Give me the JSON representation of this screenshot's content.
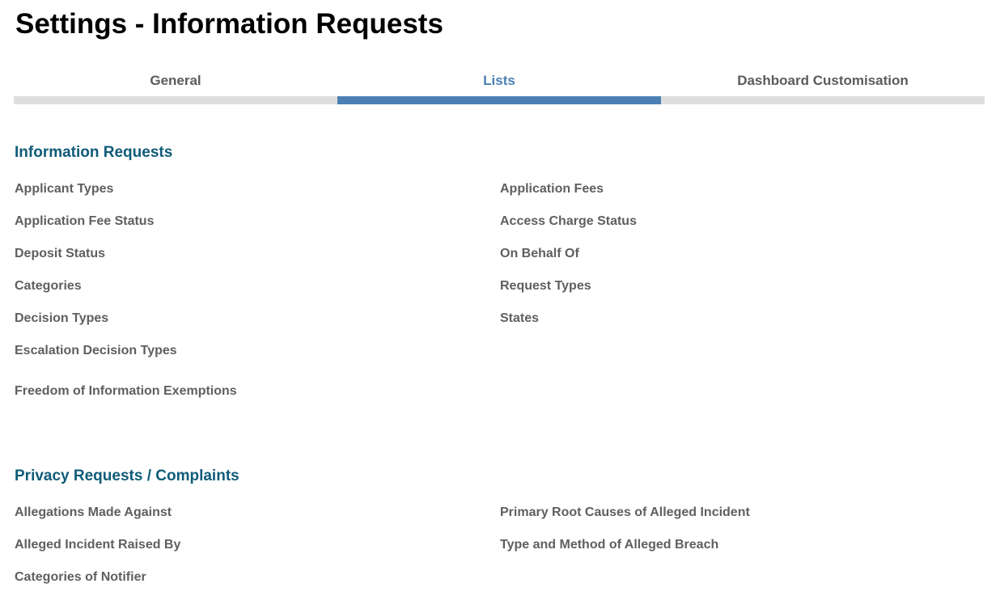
{
  "page": {
    "title": "Settings - Information Requests"
  },
  "tabs": [
    {
      "label": "General",
      "active": false
    },
    {
      "label": "Lists",
      "active": true
    },
    {
      "label": "Dashboard Customisation",
      "active": false
    }
  ],
  "colors": {
    "accent": "#4a7fb3",
    "section_heading": "#0f5b78",
    "inactive_tab_bar": "#dedede",
    "link_text": "#5f5f5f"
  },
  "information_requests": {
    "heading": "Information Requests",
    "left_items": [
      "Applicant Types",
      "Application Fee Status",
      "Deposit Status",
      "Categories",
      "Decision Types",
      "Escalation Decision Types",
      "Freedom of Information Exemptions"
    ],
    "right_items": [
      "Application Fees",
      "Access Charge Status",
      "On Behalf Of",
      "Request Types",
      "States"
    ]
  },
  "privacy_requests": {
    "heading": "Privacy Requests / Complaints",
    "left_items": [
      "Allegations Made Against",
      "Alleged Incident Raised By",
      "Categories of Notifier"
    ],
    "right_items": [
      "Primary Root Causes of Alleged Incident",
      "Type and Method of Alleged Breach"
    ]
  }
}
